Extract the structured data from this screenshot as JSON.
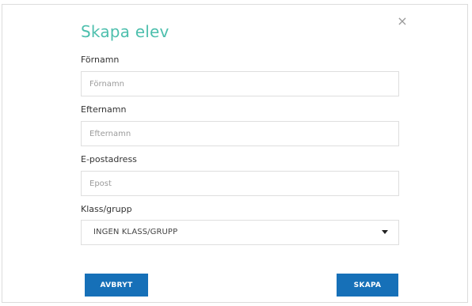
{
  "dialog": {
    "title": "Skapa elev",
    "close_glyph": "×",
    "close_icon": "close-icon"
  },
  "form": {
    "first_name": {
      "label": "Förnamn",
      "placeholder": "Förnamn",
      "value": ""
    },
    "last_name": {
      "label": "Efternamn",
      "placeholder": "Efternamn",
      "value": ""
    },
    "email": {
      "label": "E-postadress",
      "placeholder": "Epost",
      "value": ""
    },
    "class_group": {
      "label": "Klass/grupp",
      "selected": "INGEN KLASS/GRUPP"
    }
  },
  "actions": {
    "cancel_label": "AVBRYT",
    "create_label": "SKAPA"
  },
  "colors": {
    "title": "#4dbfad",
    "button": "#1670b8"
  }
}
